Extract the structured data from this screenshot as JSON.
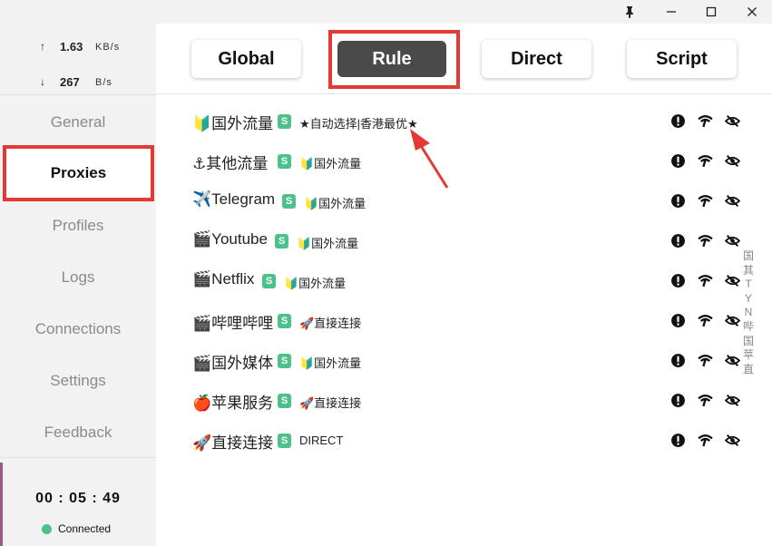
{
  "window": {
    "controls": {
      "pin": "pin-icon",
      "minimize": "minimize-icon",
      "maximize": "maximize-icon",
      "close": "close-icon"
    }
  },
  "traffic": {
    "upload": {
      "arrow": "↑",
      "value": "1.63",
      "unit": "KB/s"
    },
    "download": {
      "arrow": "↓",
      "value": "267",
      "unit": "B/s"
    }
  },
  "sidebar": {
    "items": [
      {
        "label": "General"
      },
      {
        "label": "Proxies"
      },
      {
        "label": "Profiles"
      },
      {
        "label": "Logs"
      },
      {
        "label": "Connections"
      },
      {
        "label": "Settings"
      },
      {
        "label": "Feedback"
      }
    ],
    "active": "Proxies",
    "timer": "00 : 05 : 49",
    "status": "Connected"
  },
  "modes": {
    "items": [
      {
        "label": "Global"
      },
      {
        "label": "Rule"
      },
      {
        "label": "Direct"
      },
      {
        "label": "Script"
      }
    ],
    "active": "Rule"
  },
  "groups": [
    {
      "name": "🔰国外流量",
      "type": "S",
      "selected": "★自动选择|香港最优★"
    },
    {
      "name": "⚓其他流量",
      "type": "S",
      "selected": "🔰国外流量"
    },
    {
      "name": "✈️Telegram",
      "type": "S",
      "selected": "🔰国外流量"
    },
    {
      "name": "🎬Youtube",
      "type": "S",
      "selected": "🔰国外流量"
    },
    {
      "name": "🎬Netflix",
      "type": "S",
      "selected": "🔰国外流量"
    },
    {
      "name": "🎬哔哩哔哩",
      "type": "S",
      "selected": "🚀直接连接"
    },
    {
      "name": "🎬国外媒体",
      "type": "S",
      "selected": "🔰国外流量"
    },
    {
      "name": "🍎苹果服务",
      "type": "S",
      "selected": "🚀直接连接"
    },
    {
      "name": "🚀直接连接",
      "type": "S",
      "selected": "DIRECT"
    }
  ],
  "row_actions": [
    "info-icon",
    "latency-wifi-icon",
    "hide-eye-icon"
  ],
  "side_index": [
    "国",
    "其",
    "T",
    "Y",
    "N",
    "哔",
    "国",
    "苹",
    "直"
  ],
  "colors": {
    "accent_red": "#e53935",
    "connected_green": "#4cc18a",
    "active_mode_bg": "#4a4a4a",
    "sidebar_bg": "#f2f2f2"
  }
}
